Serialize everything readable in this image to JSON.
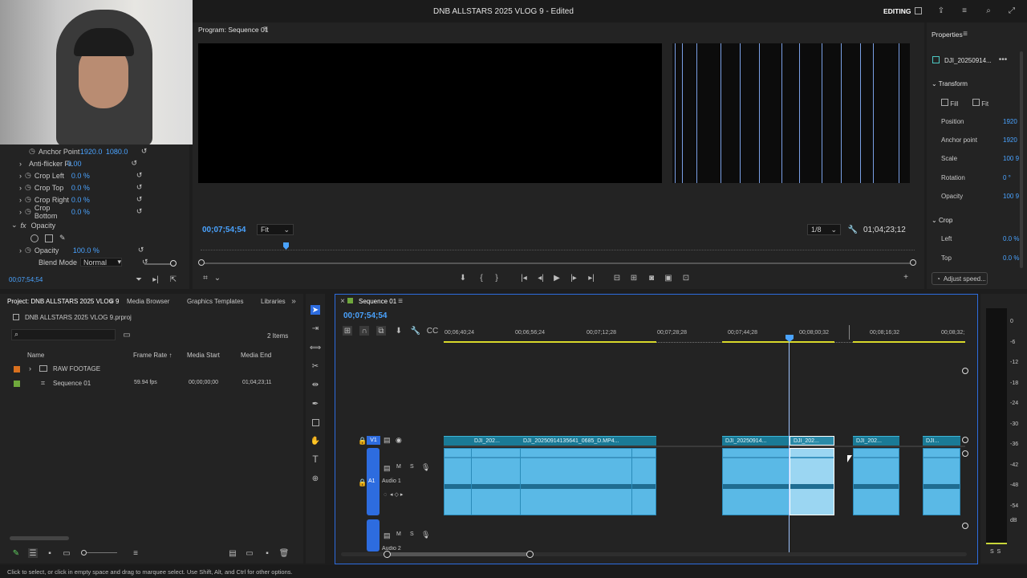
{
  "app": {
    "title": "DNB ALLSTARS 2025 VLOG 9 - Edited",
    "workspace": "EDITING"
  },
  "effect_controls": {
    "rows": [
      {
        "label": "Anchor Point",
        "v1": "1920.0",
        "v2": "1080.0"
      },
      {
        "label": "Anti-flicker Fi...",
        "v1": "0.00",
        "v2": ""
      },
      {
        "label": "Crop Left",
        "v1": "0.0 %",
        "v2": ""
      },
      {
        "label": "Crop Top",
        "v1": "0.0 %",
        "v2": ""
      },
      {
        "label": "Crop Right",
        "v1": "0.0 %",
        "v2": ""
      },
      {
        "label": "Crop Bottom",
        "v1": "0.0 %",
        "v2": ""
      }
    ],
    "opacity_section": "Opacity",
    "opacity_label": "Opacity",
    "opacity_value": "100.0 %",
    "blend_label": "Blend Mode",
    "blend_value": "Normal",
    "timecode": "00;07;54;54"
  },
  "program": {
    "title": "Program: Sequence 01",
    "timecode": "00;07;54;54",
    "fit": "Fit",
    "resolution": "1/8",
    "duration": "01;04;23;12"
  },
  "properties": {
    "title": "Properties",
    "clip_name": "DJI_20250914...",
    "transform": "Transform",
    "fill": "Fill",
    "fit": "Fit",
    "rows": [
      {
        "label": "Position",
        "value": "1920"
      },
      {
        "label": "Anchor point",
        "value": "1920"
      },
      {
        "label": "Scale",
        "value": "100 9"
      },
      {
        "label": "Rotation",
        "value": "0 °"
      },
      {
        "label": "Opacity",
        "value": "100 9"
      }
    ],
    "crop": "Crop",
    "crop_rows": [
      {
        "label": "Left",
        "value": "0.0 %"
      },
      {
        "label": "Top",
        "value": "0.0 %"
      }
    ],
    "adjust_speed": "Adjust speed..."
  },
  "project": {
    "tabs": [
      "Project: DNB ALLSTARS 2025 VLOG 9",
      "Media Browser",
      "Graphics Templates",
      "Libraries"
    ],
    "file": "DNB ALLSTARS 2025 VLOG 9.prproj",
    "items_count": "2 Items",
    "columns": [
      "Name",
      "Frame Rate",
      "Media Start",
      "Media End"
    ],
    "rows": [
      {
        "name": "RAW FOOTAGE",
        "fps": "",
        "start": "",
        "end": "",
        "color": "#d9701e"
      },
      {
        "name": "Sequence 01",
        "fps": "59.94 fps",
        "start": "00;00;00;00",
        "end": "01;04;23;11",
        "color": "#6fa83c"
      }
    ]
  },
  "timeline": {
    "tab": "Sequence 01",
    "timecode": "00;07;54;54",
    "ruler": [
      "00;06;40;24",
      "00;06;56;24",
      "00;07;12;28",
      "00;07;28;28",
      "00;07;44;28",
      "00;08;00;32",
      "00;08;16;32",
      "00;08;32;"
    ],
    "v1_label": "V1",
    "a1_label": "A1",
    "audio1": "Audio 1",
    "audio2": "Audio 2",
    "clips": [
      "DJI_202...",
      "DJI_20250914135641_0685_D.MP4...",
      "DJI_20250914...",
      "DJI_202...",
      "DJI_202...",
      "DJI..."
    ]
  },
  "meter": {
    "labels": [
      "0",
      "-6",
      "-12",
      "-18",
      "-24",
      "-30",
      "-36",
      "-42",
      "-48",
      "-54",
      "dB"
    ],
    "bottom": "S  S"
  },
  "status": "Click to select, or click in empty space and drag to marquee select. Use Shift, Alt, and Ctrl for other options."
}
